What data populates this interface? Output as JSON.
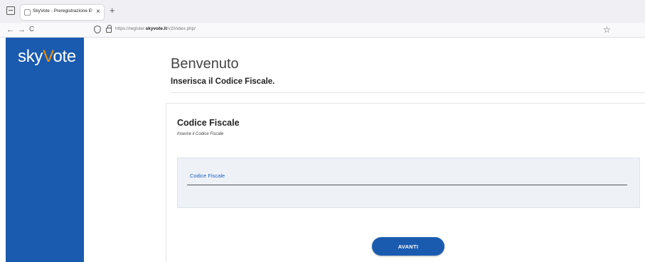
{
  "browser": {
    "tab_title": "SkyVote - Preregistrazione Eventi M",
    "tab_close": "×",
    "new_tab": "+",
    "back": "←",
    "forward": "→",
    "reload": "C",
    "url_prefix": "https://register.",
    "url_domain": "skyvote.it",
    "url_path": "/v2/index.php/",
    "bookmark": "☆"
  },
  "sidebar": {
    "logo_part1": "sky",
    "logo_accent": "V",
    "logo_part2": "ote",
    "accent_color": "#f39200",
    "bg_color": "#1a5bb0"
  },
  "header": {
    "title": "Benvenuto",
    "subtitle": "Inserisca il Codice Fiscale."
  },
  "form": {
    "title": "Codice Fiscale",
    "hint": "Inserire il Codice Fiscale",
    "field_label": "Codice Fiscale",
    "field_value": "",
    "submit_label": "AVANTI"
  }
}
